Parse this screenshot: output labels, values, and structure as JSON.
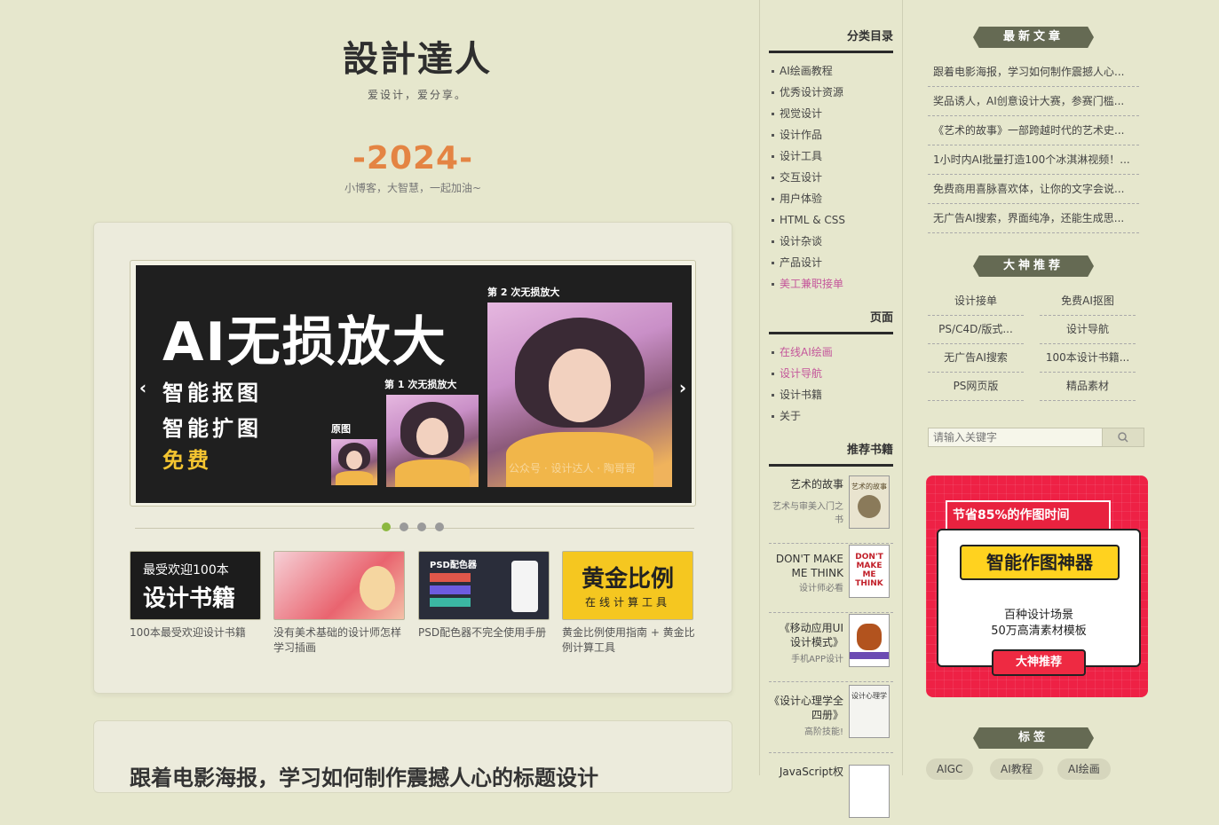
{
  "site": {
    "title": "設計達人",
    "slogan": "爱设计，爱分享。"
  },
  "banner": {
    "year": "-2024-",
    "motto": "小博客，大智慧，一起加油~"
  },
  "slide": {
    "headline": "AI无损放大",
    "line1": "智能抠图",
    "line2": "智能扩图",
    "line3": "免费",
    "cap_orig": "原图",
    "cap_first": "第 1 次无损放大",
    "cap_second": "第 2 次无损放大",
    "watermark": "公众号 · 设计达人 · 陶哥哥",
    "prev": "‹",
    "next": "›",
    "active_dot": 1,
    "dot_count": 4
  },
  "thumbs": [
    {
      "img_l1": "最受欢迎100本",
      "img_l2": "设计书籍",
      "caption": "100本最受欢迎设计书籍"
    },
    {
      "img_l1": "",
      "img_l2": "",
      "caption": "没有美术基础的设计师怎样学习插画"
    },
    {
      "img_l1": "PSD配色器",
      "img_l2": "",
      "caption": "PSD配色器不完全使用手册"
    },
    {
      "img_l1": "黄金比例",
      "img_l2": "在线计算工具",
      "caption": "黄金比例使用指南 + 黄金比例计算工具"
    }
  ],
  "post": {
    "title": "跟着电影海报，学习如何制作震撼人心的标题设计"
  },
  "categories": {
    "heading": "分类目录",
    "items": [
      "AI绘画教程",
      "优秀设计资源",
      "视觉设计",
      "设计作品",
      "设计工具",
      "交互设计",
      "用户体验",
      "HTML & CSS",
      "设计杂谈",
      "产品设计",
      "美工兼职接单"
    ]
  },
  "pages": {
    "heading": "页面",
    "items": [
      "在线AI绘画",
      "设计导航",
      "设计书籍",
      "关于"
    ]
  },
  "books": {
    "heading": "推荐书籍",
    "items": [
      {
        "title": "艺术的故事",
        "sub": "艺术与审美入门之书",
        "cover": "艺术的故事"
      },
      {
        "title": "DON'T MAKE ME THINK",
        "sub": "设计师必看",
        "cover": "DON'T MAKE ME THINK"
      },
      {
        "title": "《移动应用UI设计模式》",
        "sub": "手机APP设计",
        "cover": ""
      },
      {
        "title": "《设计心理学全四册》",
        "sub": "高阶技能!",
        "cover": "设计心理学"
      },
      {
        "title": "JavaScript权",
        "sub": "",
        "cover": ""
      }
    ]
  },
  "latest": {
    "heading": "最新文章",
    "items": [
      "跟着电影海报，学习如何制作震撼人心...",
      "奖品诱人，AI创意设计大赛，参赛门槛...",
      "《艺术的故事》一部跨越时代的艺术史...",
      "1小时内AI批量打造100个冰淇淋视频！...",
      "免费商用喜脉喜欢体，让你的文字会说...",
      "无广告AI搜索，界面纯净，还能生成思..."
    ]
  },
  "recommend": {
    "heading": "大神推荐",
    "items": [
      "设计接单",
      "免费AI抠图",
      "PS/C4D/版式...",
      "设计导航",
      "无广告AI搜索",
      "100本设计书籍...",
      "PS网页版",
      "精品素材"
    ]
  },
  "search": {
    "placeholder": "请输入关键字"
  },
  "ad": {
    "top": "节省85%的作图时间",
    "title": "智能作图神器",
    "line1": "百种设计场景",
    "line2": "50万高清素材模板",
    "button": "大神推荐"
  },
  "tags": {
    "heading": "标签",
    "items": [
      "AIGC",
      "AI教程",
      "AI绘画"
    ]
  },
  "colors": {
    "accent": "#e48443",
    "highlight": "#c4559a",
    "dot_active": "#8cb840",
    "ad_red": "#ee2145"
  }
}
